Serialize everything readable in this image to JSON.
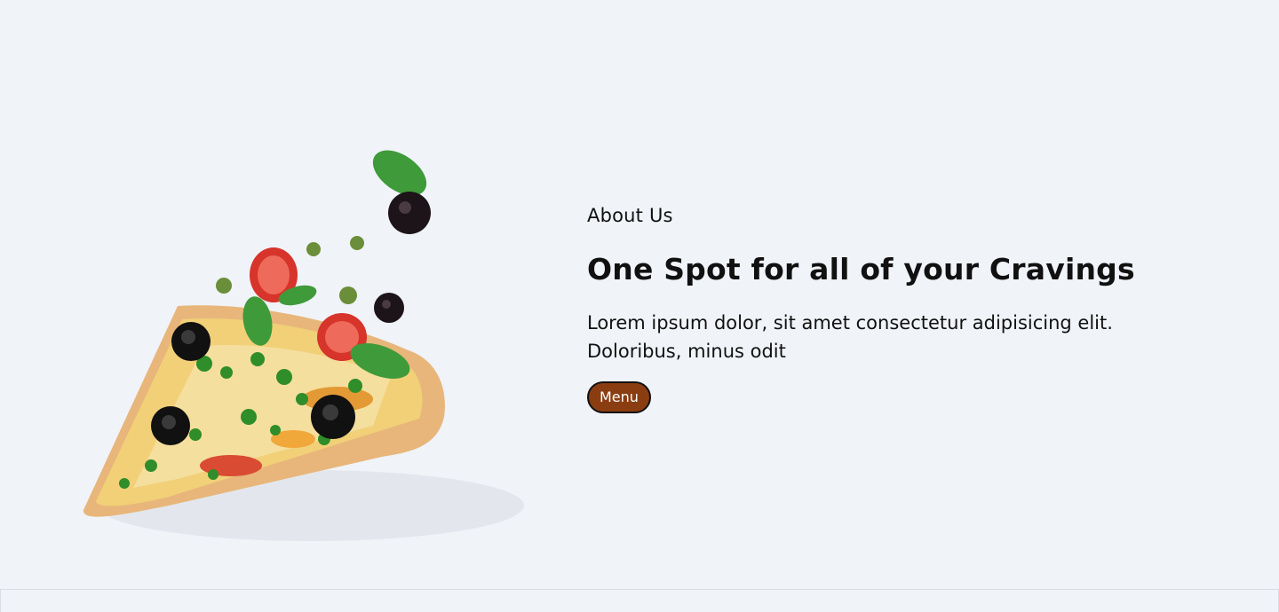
{
  "about": {
    "eyebrow": "About Us",
    "headline": "One Spot for all of your Cravings",
    "body_line1": "Lorem ipsum dolor, sit amet consectetur adipisicing elit.",
    "body_line2": "Doloribus, minus odit",
    "menu_button_label": "Menu"
  },
  "colors": {
    "background": "#f0f3f8",
    "button": "#8b3d12",
    "text": "#111111"
  },
  "image": {
    "subject": "pizza-slice-with-flying-toppings"
  }
}
